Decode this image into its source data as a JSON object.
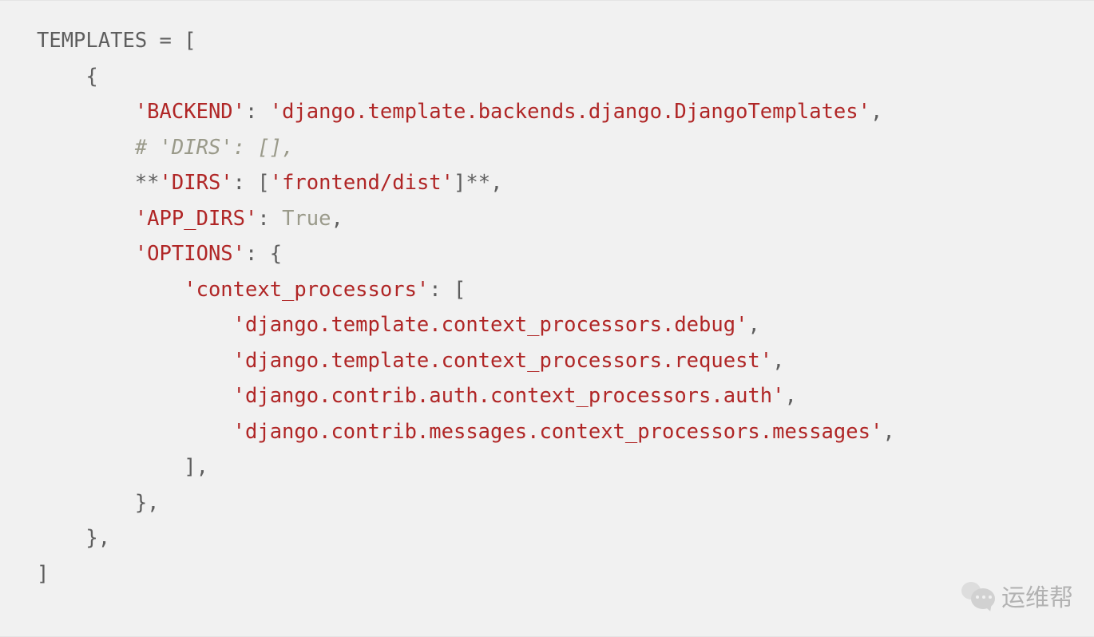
{
  "code": {
    "lines": [
      [
        {
          "t": "default",
          "v": "TEMPLATES = ["
        }
      ],
      [
        {
          "t": "default",
          "v": "    {"
        }
      ],
      [
        {
          "t": "default",
          "v": "        "
        },
        {
          "t": "string",
          "v": "'BACKEND'"
        },
        {
          "t": "default",
          "v": ": "
        },
        {
          "t": "string",
          "v": "'django.template.backends.django.DjangoTemplates'"
        },
        {
          "t": "default",
          "v": ","
        }
      ],
      [
        {
          "t": "default",
          "v": "        "
        },
        {
          "t": "comment",
          "v": "# 'DIRS': [],"
        }
      ],
      [
        {
          "t": "default",
          "v": "        **"
        },
        {
          "t": "string",
          "v": "'DIRS'"
        },
        {
          "t": "default",
          "v": ": ["
        },
        {
          "t": "string",
          "v": "'frontend/dist'"
        },
        {
          "t": "default",
          "v": "]**,"
        }
      ],
      [
        {
          "t": "default",
          "v": "        "
        },
        {
          "t": "string",
          "v": "'APP_DIRS'"
        },
        {
          "t": "default",
          "v": ": "
        },
        {
          "t": "keyword",
          "v": "True"
        },
        {
          "t": "default",
          "v": ","
        }
      ],
      [
        {
          "t": "default",
          "v": "        "
        },
        {
          "t": "string",
          "v": "'OPTIONS'"
        },
        {
          "t": "default",
          "v": ": {"
        }
      ],
      [
        {
          "t": "default",
          "v": "            "
        },
        {
          "t": "string",
          "v": "'context_processors'"
        },
        {
          "t": "default",
          "v": ": ["
        }
      ],
      [
        {
          "t": "default",
          "v": "                "
        },
        {
          "t": "string",
          "v": "'django.template.context_processors.debug'"
        },
        {
          "t": "default",
          "v": ","
        }
      ],
      [
        {
          "t": "default",
          "v": "                "
        },
        {
          "t": "string",
          "v": "'django.template.context_processors.request'"
        },
        {
          "t": "default",
          "v": ","
        }
      ],
      [
        {
          "t": "default",
          "v": "                "
        },
        {
          "t": "string",
          "v": "'django.contrib.auth.context_processors.auth'"
        },
        {
          "t": "default",
          "v": ","
        }
      ],
      [
        {
          "t": "default",
          "v": "                "
        },
        {
          "t": "string",
          "v": "'django.contrib.messages.context_processors.messages'"
        },
        {
          "t": "default",
          "v": ","
        }
      ],
      [
        {
          "t": "default",
          "v": "            ],"
        }
      ],
      [
        {
          "t": "default",
          "v": "        },"
        }
      ],
      [
        {
          "t": "default",
          "v": "    },"
        }
      ],
      [
        {
          "t": "default",
          "v": "]"
        }
      ]
    ]
  },
  "watermark": {
    "text": "运维帮"
  }
}
